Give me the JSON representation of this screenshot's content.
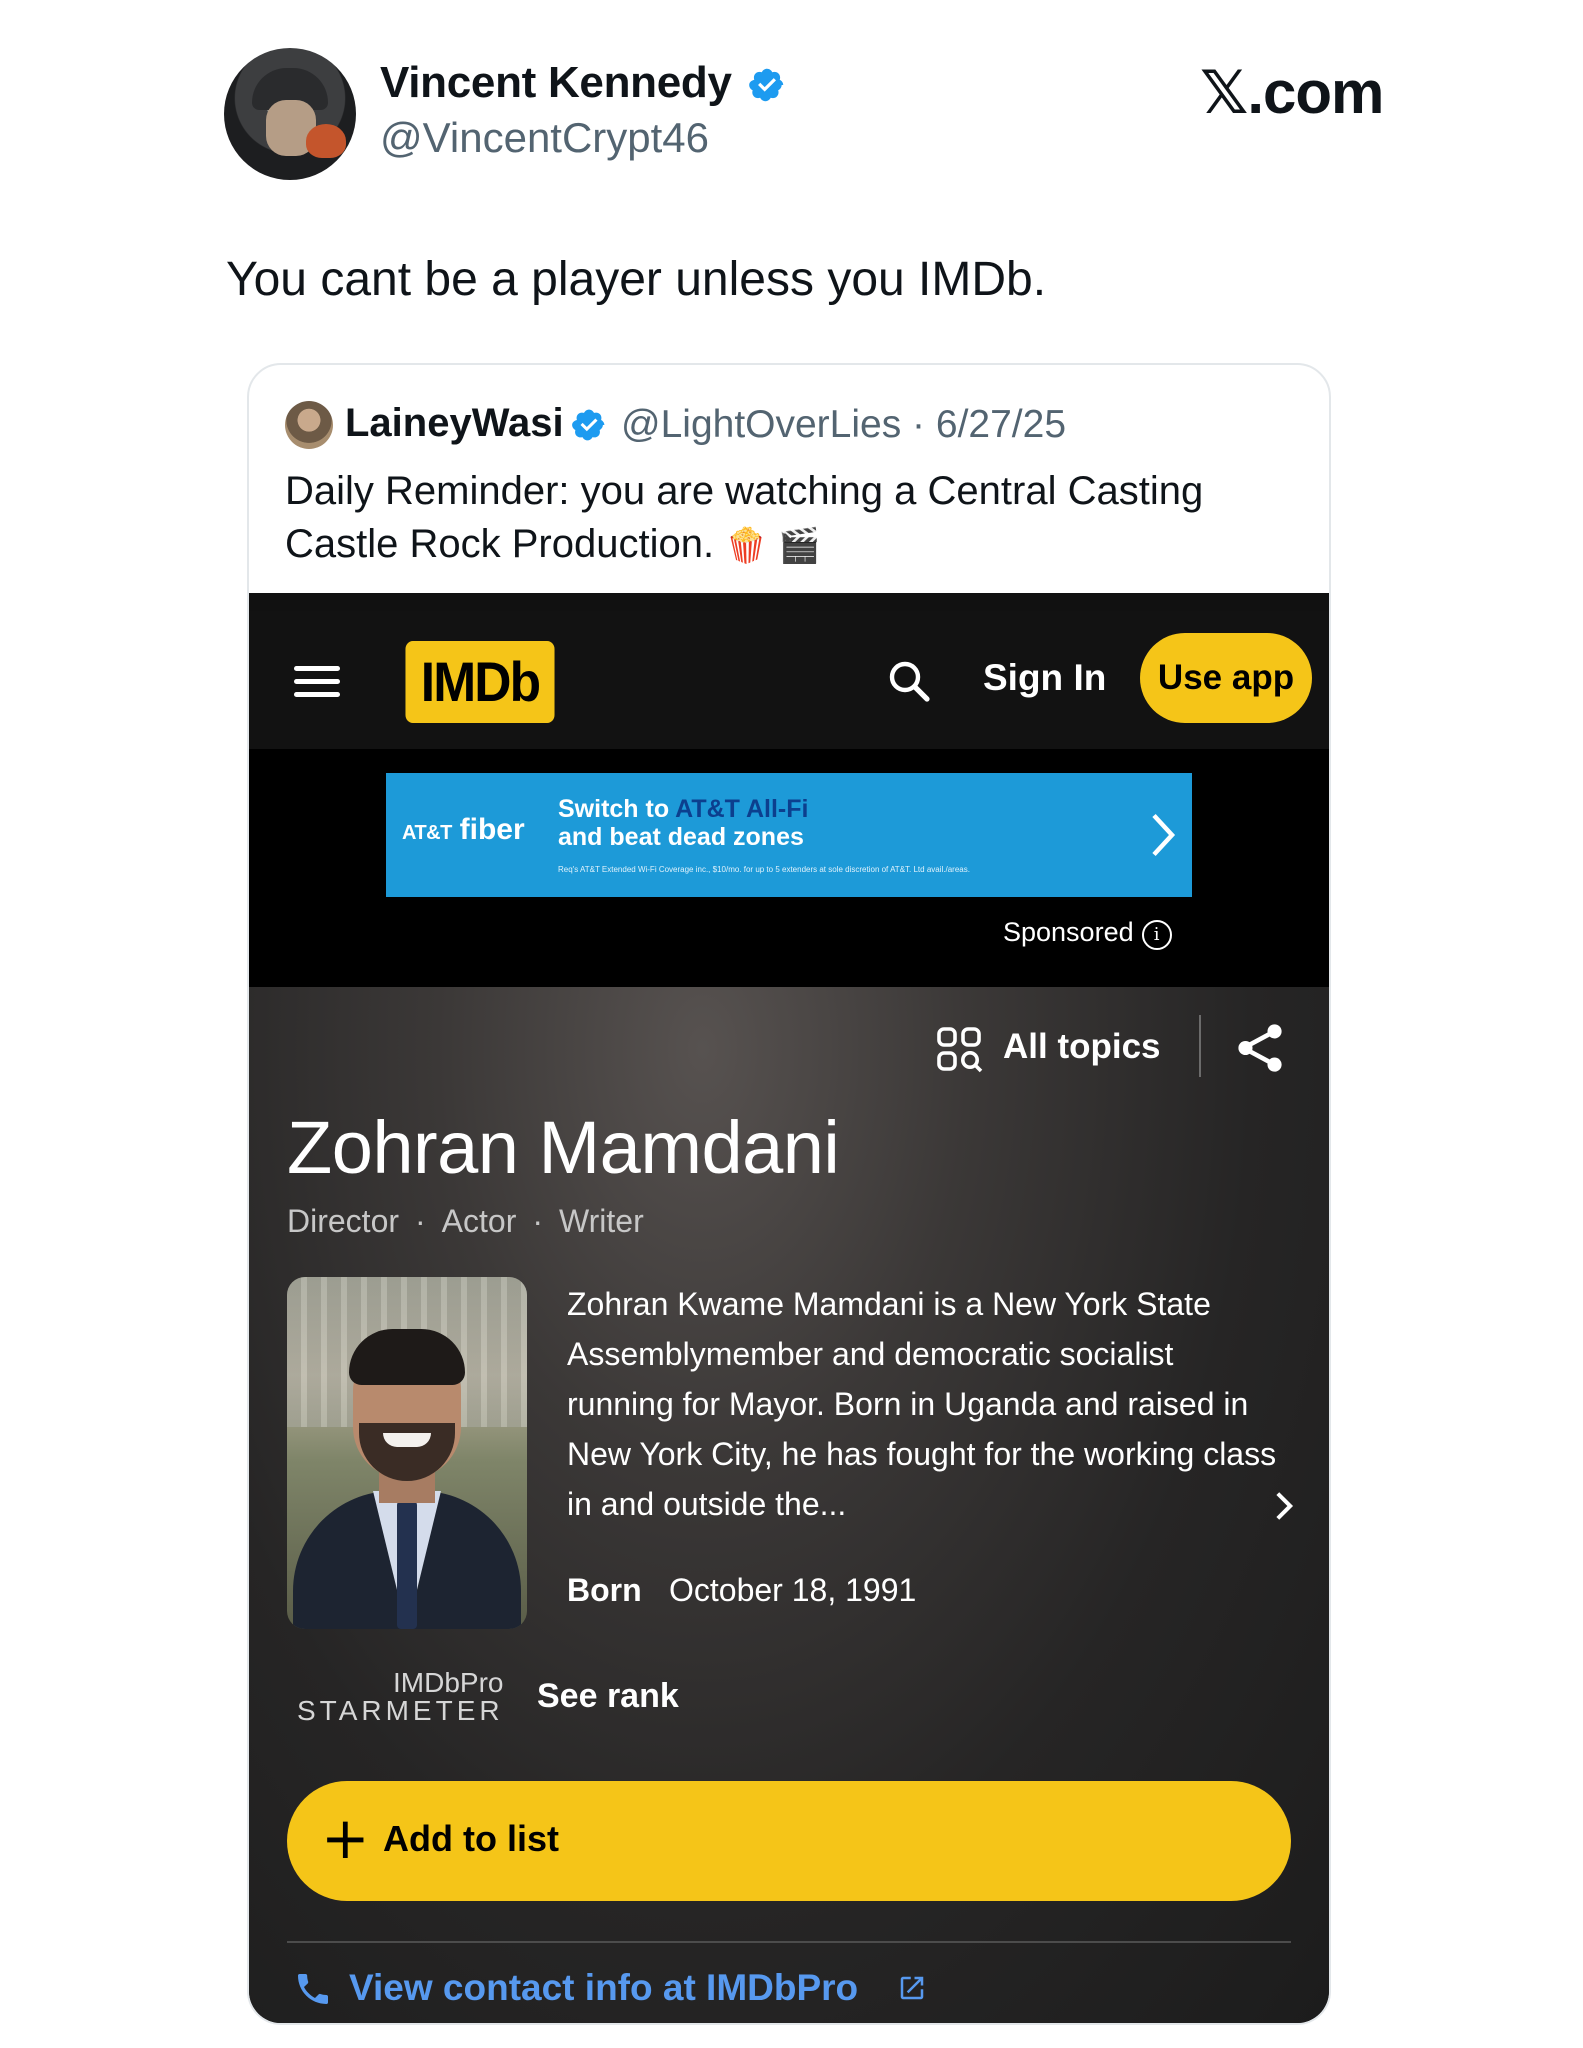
{
  "tweet": {
    "author_name": "Vincent Kennedy",
    "author_handle": "@VincentCrypt46",
    "site": ".com",
    "text": "You cant be a player unless you IMDb."
  },
  "quote": {
    "author_name": "LaineyWasi",
    "author_handle": "@LightOverLies",
    "date": "6/27/25",
    "text": "Daily Reminder: you are watching a Central Casting Castle Rock Production.",
    "emojis": "🍿 🎬"
  },
  "imdb": {
    "logo": "IMDb",
    "sign_in": "Sign In",
    "use_app": "Use app",
    "ad": {
      "brand_small": "AT&T",
      "brand_big": "fiber",
      "headline_prefix": "Switch to",
      "headline_highlight": "AT&T All-Fi",
      "headline_line2": "and beat dead zones",
      "fine_print": "Req's AT&T Extended Wi-Fi Coverage inc., $10/mo. for up to 5 extenders at sole discretion of AT&T. Ltd avail./areas."
    },
    "sponsored": "Sponsored",
    "all_topics": "All topics",
    "person": {
      "name": "Zohran Mamdani",
      "roles": [
        "Director",
        "Actor",
        "Writer"
      ],
      "bio": "Zohran Kwame Mamdani is a New York State Assemblymember and democratic socialist running for Mayor. Born in Uganda and raised in New York City, he has fought for the working class in and outside the...",
      "born_label": "Born",
      "born_value": "October 18, 1991"
    },
    "starmeter_pro": "IMDbPro",
    "starmeter_word": "STARMETER",
    "see_rank": "See rank",
    "add_to_list": "Add to list",
    "contact_link": "View contact info at IMDbPro"
  },
  "colors": {
    "x_verified": "#1d9bf0",
    "imdb_yellow": "#f5c518",
    "imdb_link": "#5799ef",
    "ad_blue": "#1d9ad8"
  }
}
